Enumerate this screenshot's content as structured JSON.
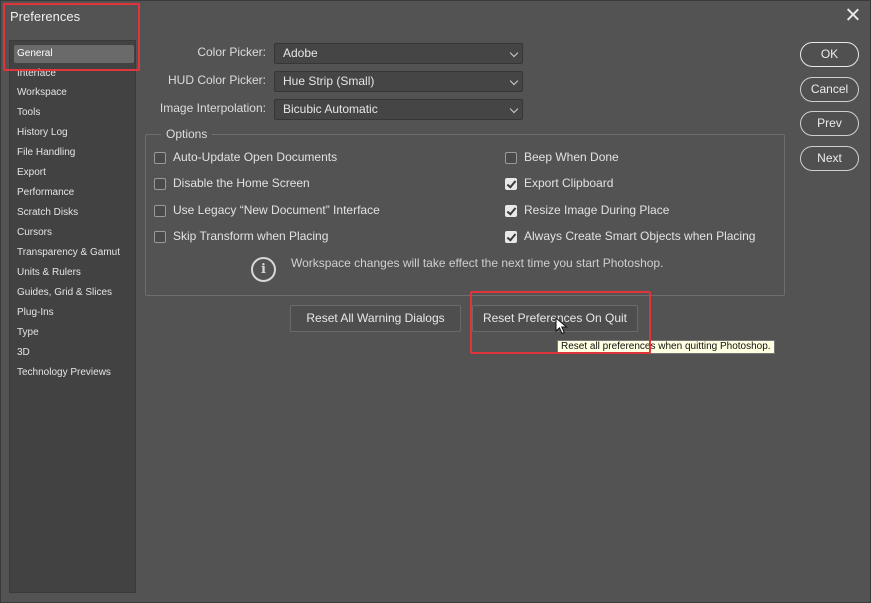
{
  "window": {
    "title": "Preferences",
    "close_label": "×"
  },
  "sidebar": {
    "items": [
      {
        "label": "General",
        "selected": true
      },
      {
        "label": "Interface"
      },
      {
        "label": "Workspace"
      },
      {
        "label": "Tools"
      },
      {
        "label": "History Log"
      },
      {
        "label": "File Handling"
      },
      {
        "label": "Export"
      },
      {
        "label": "Performance"
      },
      {
        "label": "Scratch Disks"
      },
      {
        "label": "Cursors"
      },
      {
        "label": "Transparency & Gamut"
      },
      {
        "label": "Units & Rulers"
      },
      {
        "label": "Guides, Grid & Slices"
      },
      {
        "label": "Plug-Ins"
      },
      {
        "label": "Type"
      },
      {
        "label": "3D"
      },
      {
        "label": "Technology Previews"
      }
    ]
  },
  "fields": {
    "color_picker": {
      "label": "Color Picker:",
      "value": "Adobe"
    },
    "hud_color_picker": {
      "label": "HUD Color Picker:",
      "value": "Hue Strip (Small)"
    },
    "image_interpolation": {
      "label": "Image Interpolation:",
      "value": "Bicubic Automatic"
    }
  },
  "options": {
    "legend": "Options",
    "left": [
      {
        "label": "Auto-Update Open Documents",
        "checked": false
      },
      {
        "label": "Disable the Home Screen",
        "checked": false
      },
      {
        "label": "Use Legacy “New Document” Interface",
        "checked": false
      },
      {
        "label": "Skip Transform when Placing",
        "checked": false
      }
    ],
    "right": [
      {
        "label": "Beep When Done",
        "checked": false
      },
      {
        "label": "Export Clipboard",
        "checked": true
      },
      {
        "label": "Resize Image During Place",
        "checked": true
      },
      {
        "label": "Always Create Smart Objects when Placing",
        "checked": true
      }
    ],
    "info_text": "Workspace changes will take effect the next time you start Photoshop."
  },
  "buttons": {
    "reset_warnings": "Reset All Warning Dialogs",
    "reset_prefs": "Reset Preferences On Quit",
    "ok": "OK",
    "cancel": "Cancel",
    "prev": "Prev",
    "next": "Next"
  },
  "tooltip": "Reset all preferences when quitting Photoshop.",
  "colors": {
    "background": "#535353",
    "highlight": "#e0353b",
    "tooltip_bg": "#ffffe1"
  }
}
